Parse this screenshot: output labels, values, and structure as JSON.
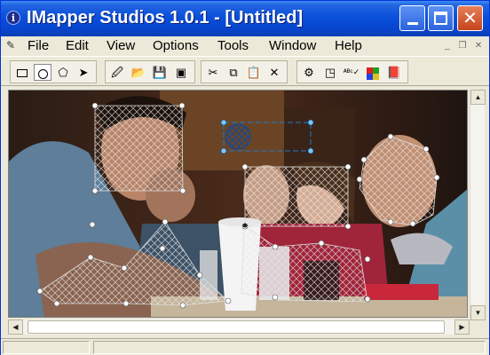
{
  "app": {
    "title": "IMapper Studios 1.0.1 - [Untitled]",
    "icon": "info-icon"
  },
  "menu": {
    "items": [
      "File",
      "Edit",
      "View",
      "Options",
      "Tools",
      "Window",
      "Help"
    ]
  },
  "toolbar": {
    "shape_tools": [
      {
        "name": "rectangle-tool",
        "icon": "rectangle-icon"
      },
      {
        "name": "circle-tool",
        "icon": "circle-icon",
        "selected": true
      },
      {
        "name": "polygon-tool",
        "icon": "polygon-icon"
      },
      {
        "name": "pointer-tool",
        "icon": "arrow-pointer-icon"
      }
    ],
    "file_tools": [
      "edit-image-icon",
      "open-folder-icon",
      "save-icon",
      "save-all-icon"
    ],
    "edit_tools": [
      "cut-icon",
      "copy-icon",
      "paste-icon",
      "delete-icon"
    ],
    "misc_tools": [
      "properties-icon",
      "crop-icon",
      "spell-check-icon",
      "color-palette-icon",
      "help-book-icon"
    ]
  },
  "colors": {
    "titlebar": "#0a50da",
    "selection": "#1e7ac8",
    "hotspot_handle": "#ffffff"
  },
  "status": {
    "pane1": "",
    "pane2": ""
  }
}
